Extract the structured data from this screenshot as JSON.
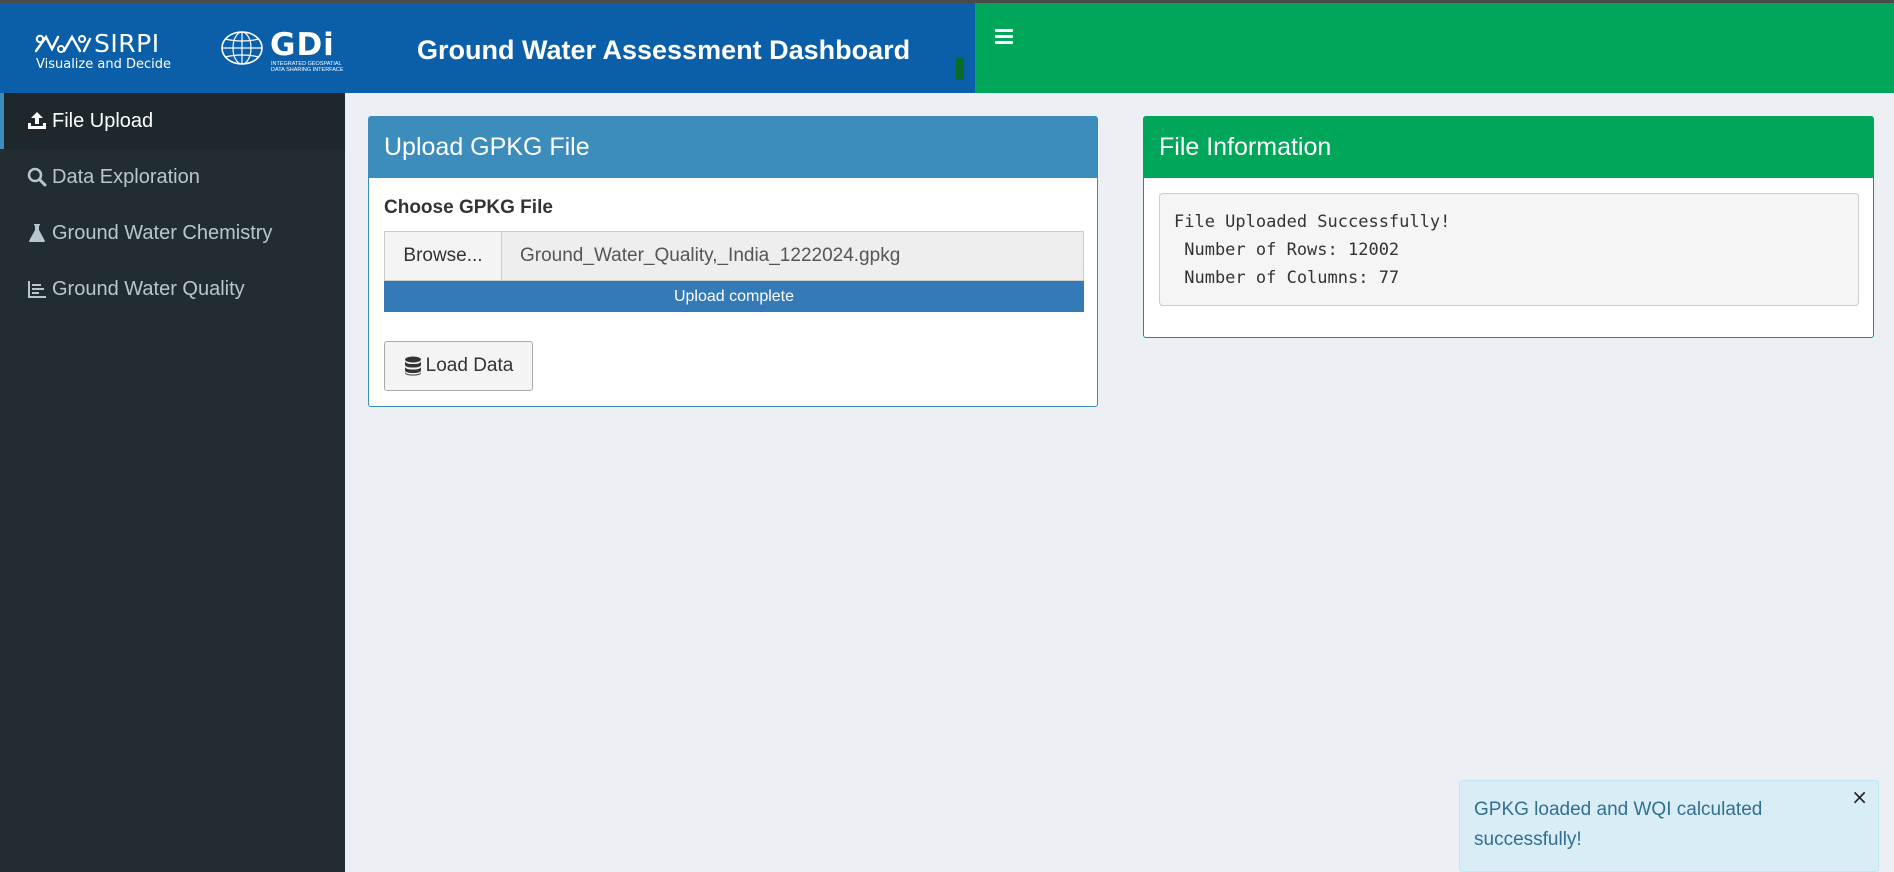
{
  "header": {
    "sirpi_logo_text": "SIRPI",
    "sirpi_tagline": "Visualize and Decide",
    "gdi_logo_text": "GDi",
    "gdi_subtext_line1": "INTEGRATED GEOSPATIAL",
    "gdi_subtext_line2": "DATA SHARING INTERFACE",
    "title": "Ground Water Assessment Dashboard",
    "colors": {
      "brand": "#0b5ea8",
      "navbar": "#00a65a"
    }
  },
  "sidebar": {
    "items": [
      {
        "label": "File Upload",
        "icon": "upload-icon",
        "active": true
      },
      {
        "label": "Data Exploration",
        "icon": "search-icon",
        "active": false
      },
      {
        "label": "Ground Water Chemistry",
        "icon": "flask-icon",
        "active": false
      },
      {
        "label": "Ground Water Quality",
        "icon": "chart-icon",
        "active": false
      }
    ]
  },
  "upload_box": {
    "title": "Upload GPKG File",
    "field_label": "Choose GPKG File",
    "browse_label": "Browse...",
    "file_name": "Ground_Water_Quality,_India_1222024.gpkg",
    "progress_text": "Upload complete",
    "progress_percent": 100,
    "load_button_label": "Load Data"
  },
  "info_box": {
    "title": "File Information",
    "lines": [
      "File Uploaded Successfully!",
      " Number of Rows: 12002",
      " Number of Columns: 77"
    ]
  },
  "notification": {
    "message": "GPKG loaded and WQI calculated successfully!",
    "close_label": "×"
  }
}
